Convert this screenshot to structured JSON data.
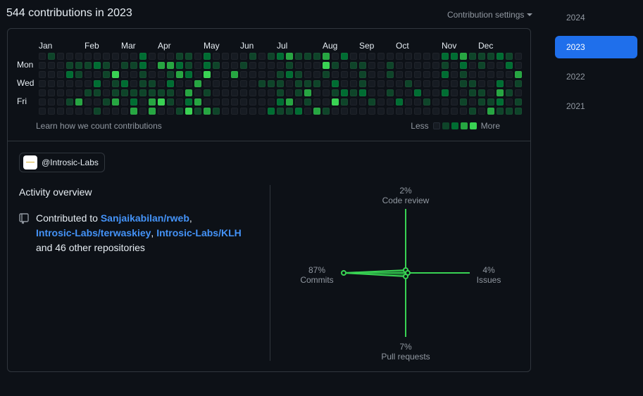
{
  "header": {
    "title": "544 contributions in 2023",
    "settings_label": "Contribution settings"
  },
  "graph": {
    "months": [
      "Jan",
      "Feb",
      "Mar",
      "Apr",
      "May",
      "Jun",
      "Jul",
      "Aug",
      "Sep",
      "Oct",
      "Nov",
      "Dec"
    ],
    "days": [
      "Mon",
      "Wed",
      "Fri"
    ],
    "learn_link": "Learn how we count contributions",
    "legend_less": "Less",
    "legend_more": "More",
    "levels": [
      "#161b22",
      "#0e4429",
      "#006d32",
      "#26a641",
      "#39d353"
    ]
  },
  "org": {
    "handle": "@Introsic-Labs"
  },
  "overview": {
    "title": "Activity overview",
    "contributed_prefix": "Contributed to ",
    "repo1": "Sanjaikabilan/rweb",
    "sep1": ",",
    "repo2": "Introsic-Labs/terwaskiey",
    "sep2": ", ",
    "repo3": "Introsic-Labs/KLH",
    "suffix": "and 46 other repositories"
  },
  "radar": {
    "code_review_pct": "2%",
    "code_review_label": "Code review",
    "issues_pct": "4%",
    "issues_label": "Issues",
    "pull_requests_pct": "7%",
    "pull_requests_label": "Pull requests",
    "commits_pct": "87%",
    "commits_label": "Commits"
  },
  "years": [
    "2024",
    "2023",
    "2022",
    "2021"
  ],
  "selected_year": "2023"
}
